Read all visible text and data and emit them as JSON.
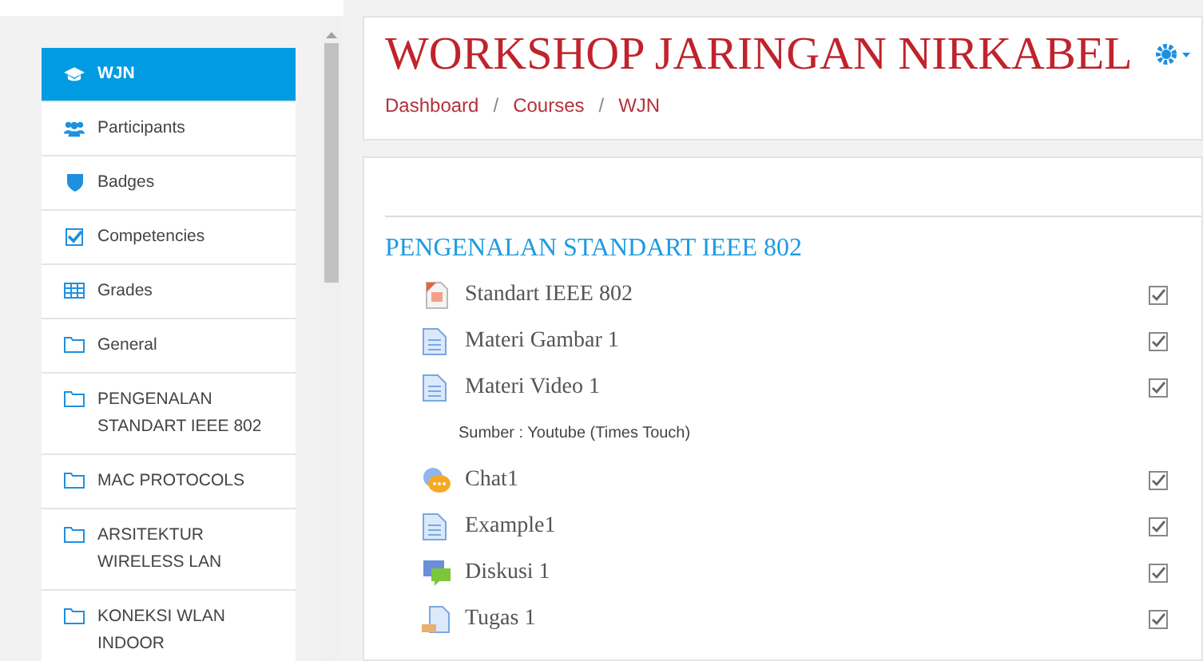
{
  "sidebar": {
    "items": [
      {
        "kind": "course",
        "label": "WJN",
        "selected": true
      },
      {
        "kind": "participants",
        "label": "Participants",
        "selected": false
      },
      {
        "kind": "badges",
        "label": "Badges",
        "selected": false
      },
      {
        "kind": "competencies",
        "label": "Competencies",
        "selected": false
      },
      {
        "kind": "grades",
        "label": "Grades",
        "selected": false
      },
      {
        "kind": "section",
        "label": "General",
        "selected": false
      },
      {
        "kind": "section",
        "label": "PENGENALAN STANDART IEEE 802",
        "selected": false
      },
      {
        "kind": "section",
        "label": "MAC PROTOCOLS",
        "selected": false
      },
      {
        "kind": "section",
        "label": "ARSITEKTUR WIRELESS LAN",
        "selected": false
      },
      {
        "kind": "section",
        "label": "KONEKSI WLAN INDOOR",
        "selected": false
      }
    ]
  },
  "header": {
    "title": "WORKSHOP JARINGAN NIRKABEL",
    "breadcrumb": [
      "Dashboard",
      "Courses",
      "WJN"
    ],
    "separator": "/"
  },
  "section": {
    "title": "PENGENALAN STANDART IEEE 802",
    "activities": [
      {
        "kind": "ppt",
        "name": "Standart IEEE 802",
        "checked": true
      },
      {
        "kind": "page",
        "name": "Materi Gambar 1",
        "checked": true
      },
      {
        "kind": "page",
        "name": "Materi Video 1",
        "checked": true,
        "description": "Sumber : Youtube (Times Touch)"
      },
      {
        "kind": "chat",
        "name": "Chat1",
        "checked": true
      },
      {
        "kind": "page",
        "name": "Example1",
        "checked": true
      },
      {
        "kind": "forum",
        "name": "Diskusi 1",
        "checked": true
      },
      {
        "kind": "assign",
        "name": "Tugas 1",
        "checked": true
      }
    ]
  }
}
